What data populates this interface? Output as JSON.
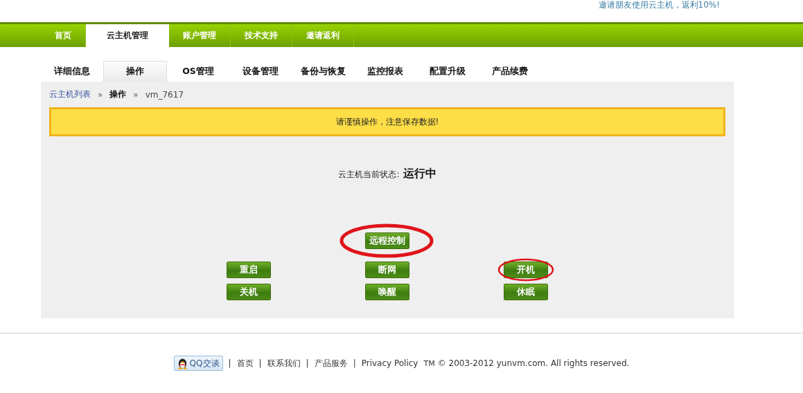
{
  "header": {
    "invite_link": "邀请朋友使用云主机，返利10%!"
  },
  "main_nav": [
    {
      "label": "首页",
      "selected": false
    },
    {
      "label": "云主机管理",
      "selected": true
    },
    {
      "label": "账户管理",
      "selected": false
    },
    {
      "label": "技术支持",
      "selected": false
    },
    {
      "label": "邀请返利",
      "selected": false
    }
  ],
  "sub_tabs": [
    {
      "label": "详细信息",
      "selected": false
    },
    {
      "label": "操作",
      "selected": true
    },
    {
      "label": "OS管理",
      "selected": false
    },
    {
      "label": "设备管理",
      "selected": false
    },
    {
      "label": "备份与恢复",
      "selected": false
    },
    {
      "label": "监控报表",
      "selected": false
    },
    {
      "label": "配置升级",
      "selected": false
    },
    {
      "label": "产品续费",
      "selected": false
    }
  ],
  "breadcrumb": [
    {
      "label": "云主机列表",
      "kind": "link"
    },
    {
      "label": "»",
      "kind": "sep"
    },
    {
      "label": "操作",
      "kind": "current"
    },
    {
      "label": "»",
      "kind": "sep"
    },
    {
      "label": "vm_7617",
      "kind": "plain"
    }
  ],
  "warning": "请谨慎操作，注意保存数据!",
  "status": {
    "label": "云主机当前状态:",
    "value": "运行中"
  },
  "remote_button": {
    "label": "远程控制",
    "circled": true
  },
  "action_buttons": [
    {
      "label": "重启",
      "circled": false
    },
    {
      "label": "断网",
      "circled": false
    },
    {
      "label": "开机",
      "circled": true
    },
    {
      "label": "关机",
      "circled": false
    },
    {
      "label": "唤醒",
      "circled": false
    },
    {
      "label": "休眠",
      "circled": false
    }
  ],
  "footer": {
    "chat_button": "QQ交谈",
    "links": [
      "首页",
      "联系我们",
      "产品服务",
      "Privacy Policy"
    ],
    "separator": "|",
    "tm": "TM",
    "copyright": "© 2003-2012 yunvm.com. All rights reserved."
  }
}
